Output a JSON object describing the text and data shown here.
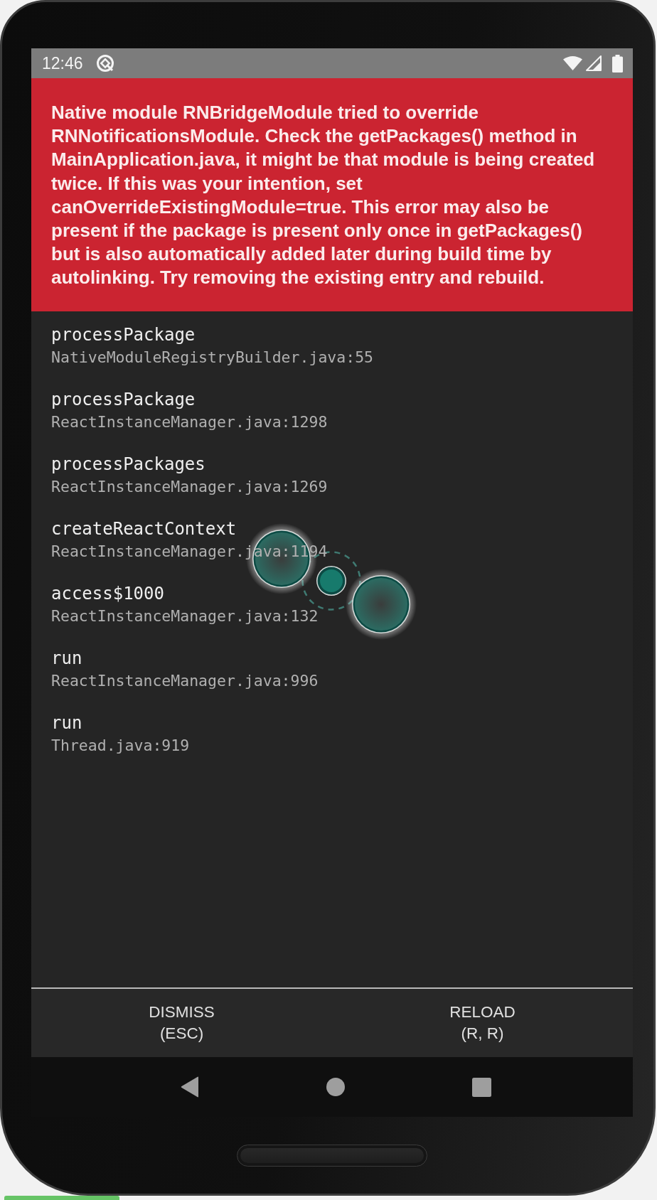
{
  "status_bar": {
    "time": "12:46"
  },
  "error": {
    "message": "Native module RNBridgeModule tried to override RNNotificationsModule. Check the getPackages() method in MainApplication.java, it might be that module is being created twice. If this was your intention, set canOverrideExistingModule=true. This error may also be present if the package is present only once in getPackages() but is also automatically added later during build time by autolinking. Try removing the existing entry and rebuild."
  },
  "stack_frames": [
    {
      "method": "processPackage",
      "location": "NativeModuleRegistryBuilder.java:55"
    },
    {
      "method": "processPackage",
      "location": "ReactInstanceManager.java:1298"
    },
    {
      "method": "processPackages",
      "location": "ReactInstanceManager.java:1269"
    },
    {
      "method": "createReactContext",
      "location": "ReactInstanceManager.java:1194"
    },
    {
      "method": "access$1000",
      "location": "ReactInstanceManager.java:132"
    },
    {
      "method": "run",
      "location": "ReactInstanceManager.java:996"
    },
    {
      "method": "run",
      "location": "Thread.java:919"
    }
  ],
  "buttons": [
    {
      "label": "DISMISS",
      "shortcut": "(ESC)"
    },
    {
      "label": "RELOAD",
      "shortcut": "(R, R)"
    }
  ]
}
